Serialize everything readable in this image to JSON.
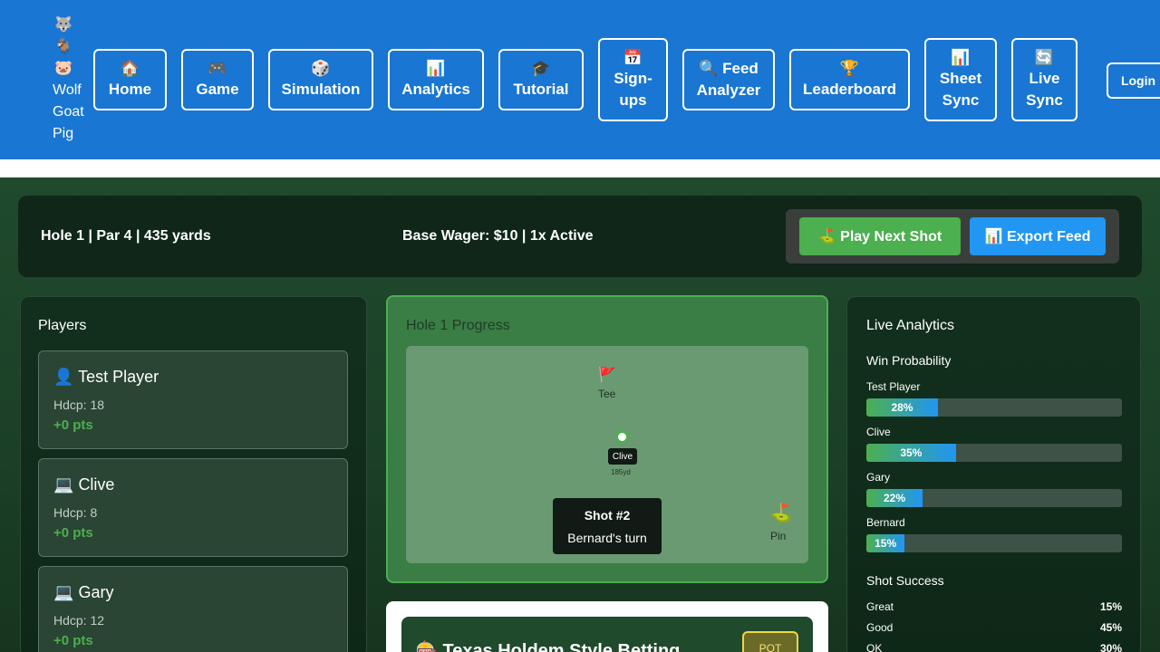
{
  "nav": {
    "brand": {
      "icons": [
        "🐺",
        "🐐",
        "🐷"
      ],
      "lines": [
        "Wolf",
        "Goat",
        "Pig"
      ]
    },
    "items": [
      {
        "icon": "🏠",
        "label": "Home"
      },
      {
        "icon": "🎮",
        "label": "Game"
      },
      {
        "icon": "🎲",
        "label": "Simulation"
      },
      {
        "icon": "📊",
        "label": "Analytics"
      },
      {
        "icon": "🎓",
        "label": "Tutorial"
      },
      {
        "icon": "📅",
        "label1": "Sign-",
        "label2": "ups"
      },
      {
        "icon": "🔍",
        "label1": "Feed",
        "label2": "Analyzer"
      },
      {
        "icon": "🏆",
        "label": "Leaderboard"
      },
      {
        "icon": "📊",
        "label1": "Sheet",
        "label2": "Sync"
      },
      {
        "icon": "🔄",
        "label1": "Live",
        "label2": "Sync"
      }
    ],
    "login": "Login",
    "color": "#1976d2"
  },
  "info": {
    "hole": "Hole 1 | Par 4 | 435 yards",
    "wager": "Base Wager: $10 | 1x Active",
    "play_btn": "⛳ Play Next Shot",
    "export_btn": "📊 Export Feed"
  },
  "players": {
    "title": "Players",
    "list": [
      {
        "icon": "👤",
        "name": "Test Player",
        "hdcp": "Hdcp: 18",
        "pts": "+0 pts"
      },
      {
        "icon": "💻",
        "name": "Clive",
        "hdcp": "Hdcp: 8",
        "pts": "+0 pts"
      },
      {
        "icon": "💻",
        "name": "Gary",
        "hdcp": "Hdcp: 12",
        "pts": "+0 pts"
      }
    ]
  },
  "hole": {
    "title": "Hole 1 Progress",
    "tee_flag": "🚩",
    "tee_label": "Tee",
    "ball_player": "Clive",
    "ball_distance": "185yd",
    "pin_icon": "⛳",
    "pin_label": "Pin",
    "shot_title": "Shot #2",
    "shot_turn": "Bernard's turn"
  },
  "betting": {
    "title": "🎰 Texas Holdem Style Betting",
    "pot_label": "POT"
  },
  "analytics": {
    "title": "Live Analytics",
    "win_title": "Win Probability",
    "win": [
      {
        "name": "Test Player",
        "label": "28%",
        "value": 0.28
      },
      {
        "name": "Clive",
        "label": "35%",
        "value": 0.35
      },
      {
        "name": "Gary",
        "label": "22%",
        "value": 0.22
      },
      {
        "name": "Bernard",
        "label": "15%",
        "value": 0.15
      }
    ],
    "shot_title": "Shot Success",
    "shots": [
      {
        "label": "Great",
        "value": "15%"
      },
      {
        "label": "Good",
        "value": "45%"
      },
      {
        "label": "OK",
        "value": "30%"
      }
    ]
  },
  "colors": {
    "accent_green": "#4caf50",
    "accent_blue": "#2196f3"
  }
}
